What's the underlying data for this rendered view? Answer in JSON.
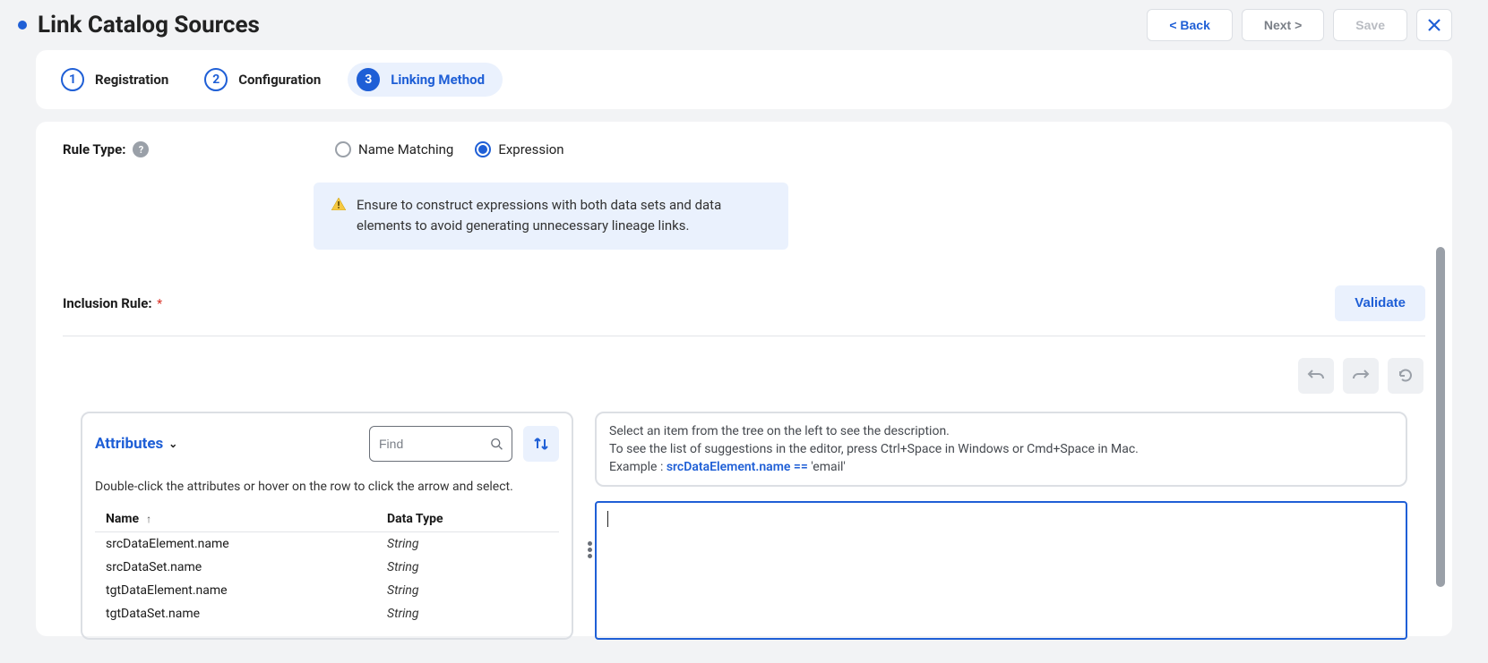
{
  "header": {
    "title": "Link Catalog Sources",
    "back": "< Back",
    "next": "Next >",
    "save": "Save"
  },
  "steps": [
    {
      "num": "1",
      "label": "Registration"
    },
    {
      "num": "2",
      "label": "Configuration"
    },
    {
      "num": "3",
      "label": "Linking Method"
    }
  ],
  "ruleType": {
    "label": "Rule Type:",
    "options": {
      "name_matching": "Name Matching",
      "expression": "Expression"
    }
  },
  "banner": "Ensure to construct expressions with both data sets and data elements to avoid generating unnecessary lineage links.",
  "inclusion": {
    "label": "Inclusion Rule:",
    "validate": "Validate"
  },
  "attributes": {
    "title": "Attributes",
    "find_placeholder": "Find",
    "help": "Double-click the attributes or hover on the row to click the arrow and select.",
    "columns": {
      "name": "Name",
      "type": "Data Type"
    },
    "rows": [
      {
        "name": "srcDataElement.name",
        "type": "String"
      },
      {
        "name": "srcDataSet.name",
        "type": "String"
      },
      {
        "name": "tgtDataElement.name",
        "type": "String"
      },
      {
        "name": "tgtDataSet.name",
        "type": "String"
      }
    ]
  },
  "description": {
    "line1": "Select an item from the tree on the left to see the description.",
    "line2": "To see the list of suggestions in the editor, press Ctrl+Space in Windows or Cmd+Space in Mac.",
    "example_label": "Example : ",
    "example_expr": "srcDataElement.name == ",
    "example_tail": "'email'"
  }
}
